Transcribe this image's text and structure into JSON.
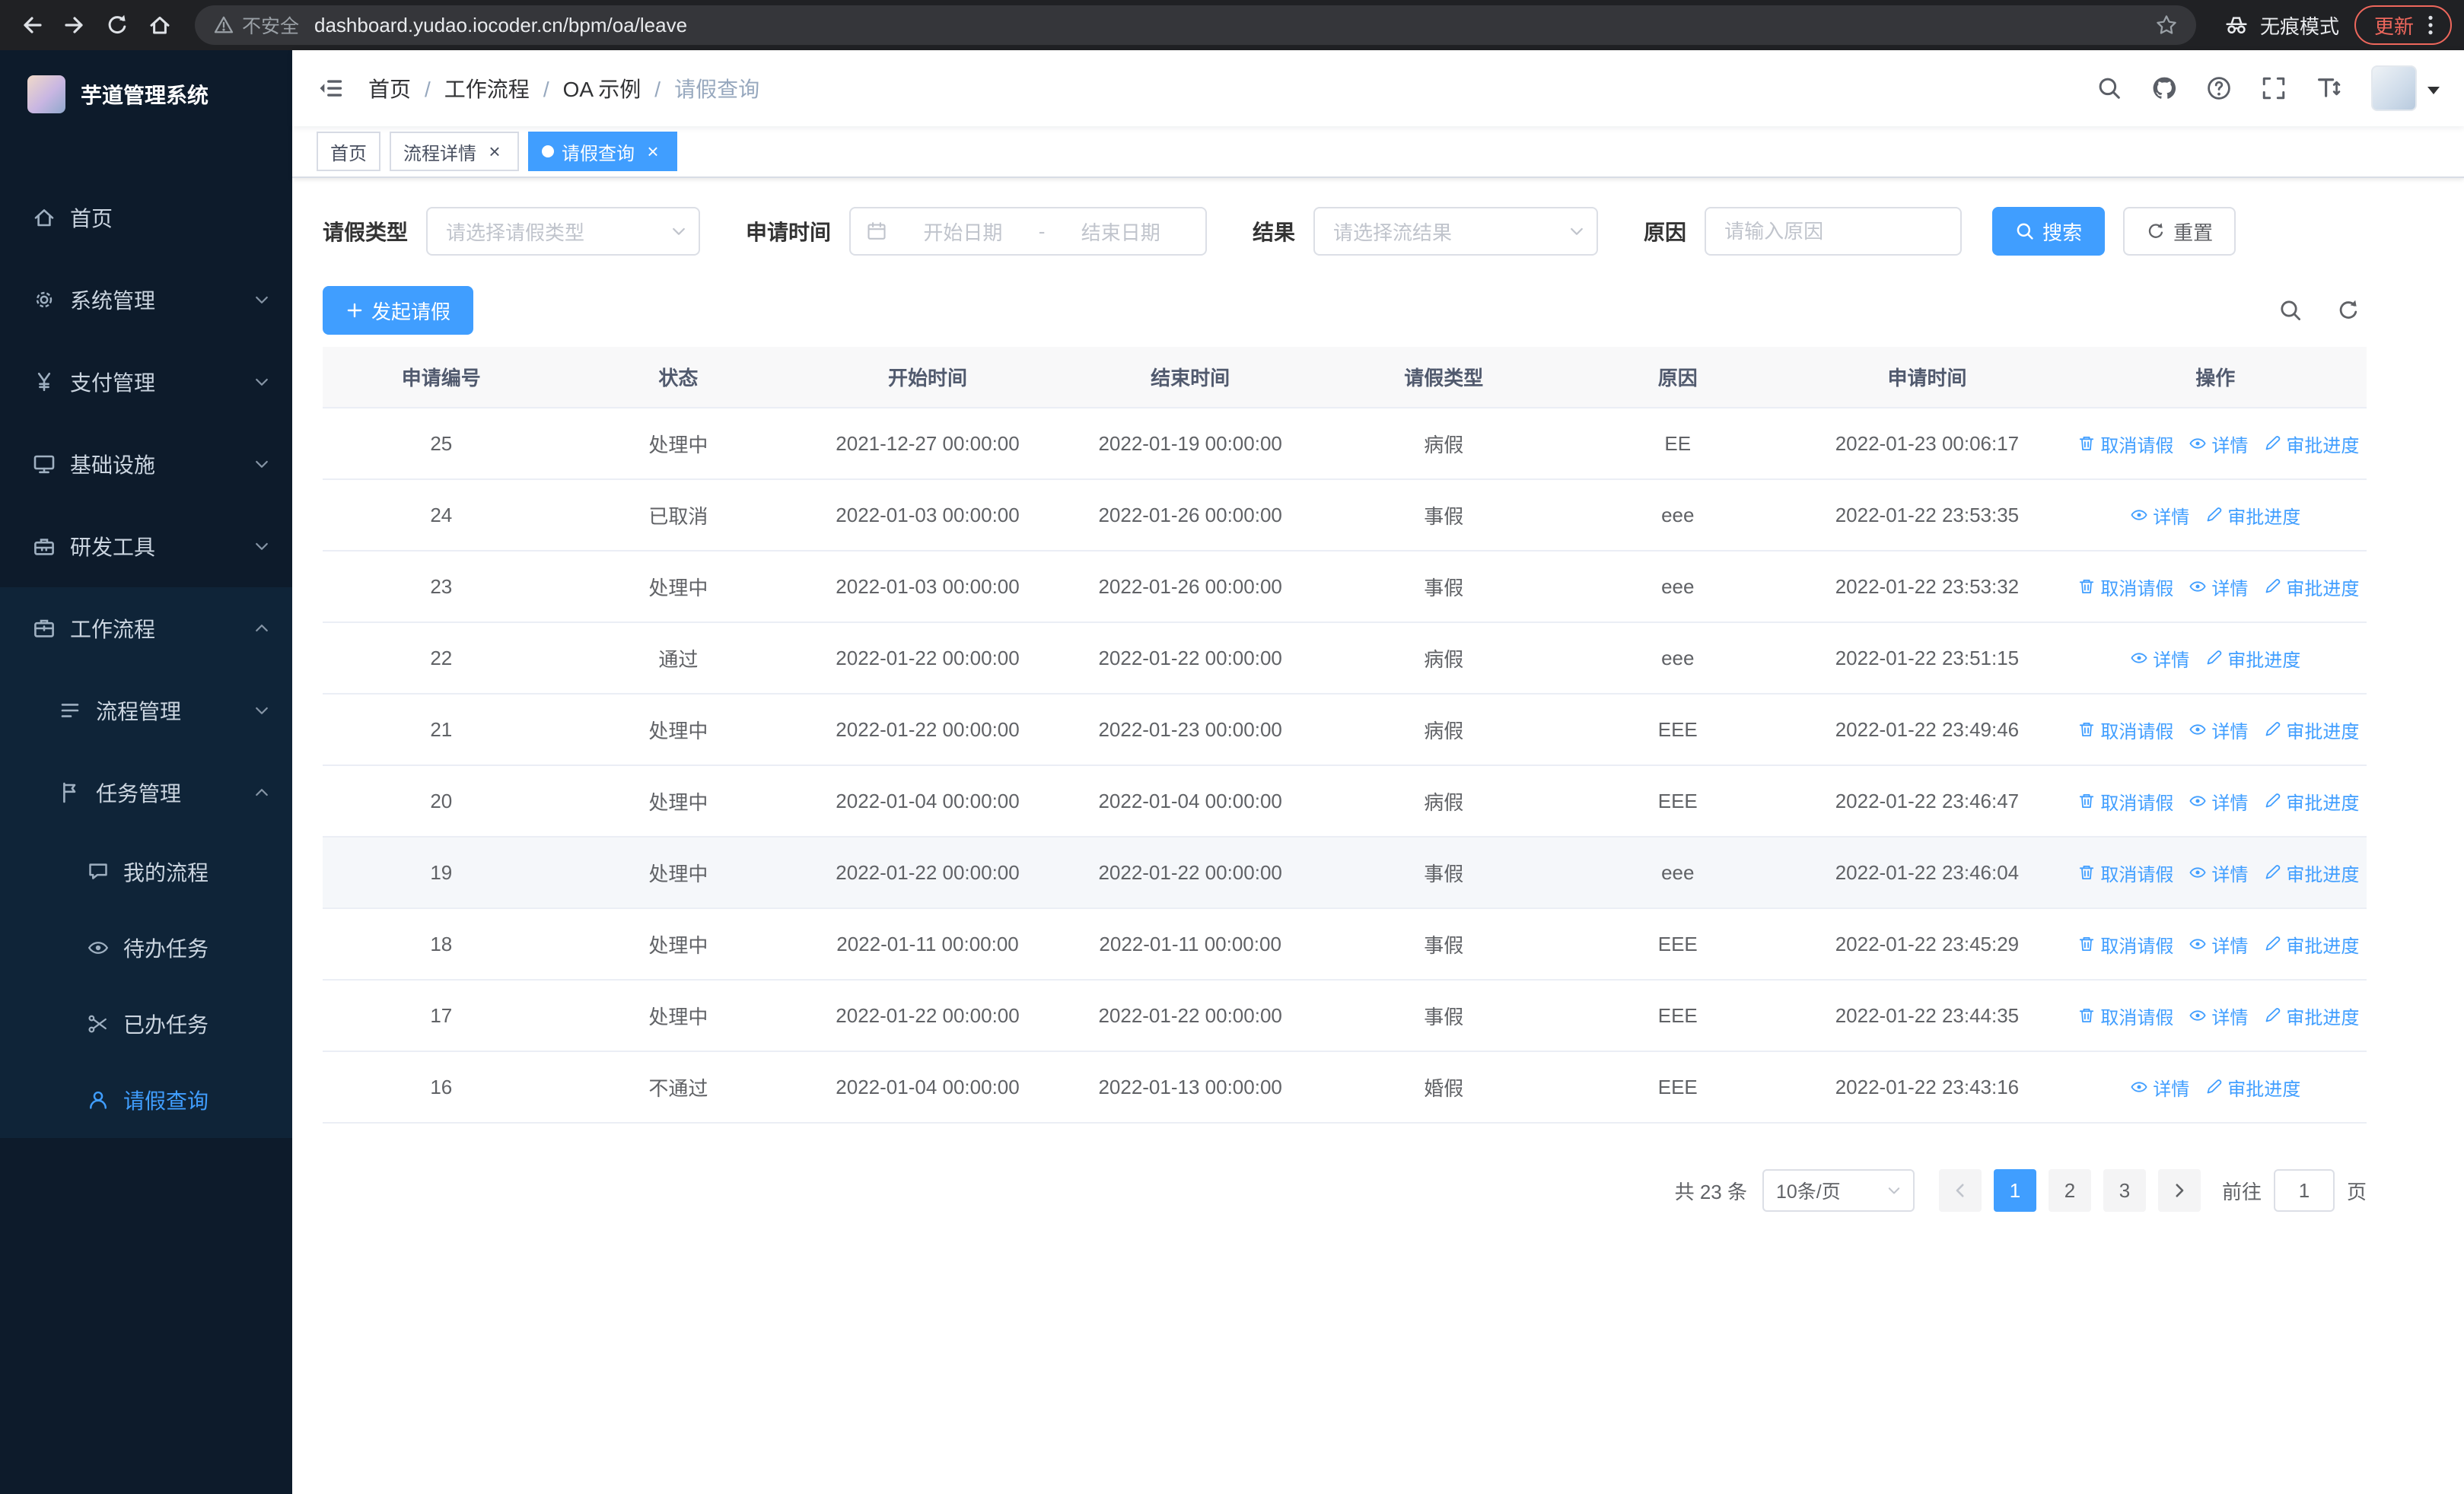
{
  "browser": {
    "security_warning": "不安全",
    "url": "dashboard.yudao.iocoder.cn/bpm/oa/leave",
    "incognito_label": "无痕模式",
    "update_label": "更新"
  },
  "sidebar": {
    "logo_title": "芋道管理系统",
    "items": [
      {
        "label": "首页"
      },
      {
        "label": "系统管理"
      },
      {
        "label": "支付管理"
      },
      {
        "label": "基础设施"
      },
      {
        "label": "研发工具"
      },
      {
        "label": "工作流程"
      }
    ],
    "workflow_children": [
      {
        "label": "流程管理"
      },
      {
        "label": "任务管理"
      }
    ],
    "task_children": [
      {
        "label": "我的流程"
      },
      {
        "label": "待办任务"
      },
      {
        "label": "已办任务"
      },
      {
        "label": "请假查询",
        "active": true
      }
    ]
  },
  "header": {
    "breadcrumb": [
      "首页",
      "工作流程",
      "OA 示例",
      "请假查询"
    ]
  },
  "tabs": [
    {
      "label": "首页"
    },
    {
      "label": "流程详情",
      "closable": true
    },
    {
      "label": "请假查询",
      "closable": true,
      "active": true
    }
  ],
  "filters": {
    "leave_type_label": "请假类型",
    "leave_type_placeholder": "请选择请假类型",
    "apply_time_label": "申请时间",
    "date_start_placeholder": "开始日期",
    "date_separator": "-",
    "date_end_placeholder": "结束日期",
    "result_label": "结果",
    "result_placeholder": "请选择流结果",
    "reason_label": "原因",
    "reason_placeholder": "请输入原因",
    "search_button": "搜索",
    "reset_button": "重置"
  },
  "toolbar": {
    "create_button": "发起请假"
  },
  "table": {
    "columns": [
      "申请编号",
      "状态",
      "开始时间",
      "结束时间",
      "请假类型",
      "原因",
      "申请时间",
      "操作"
    ],
    "action_labels": {
      "cancel": "取消请假",
      "detail": "详情",
      "progress": "审批进度"
    },
    "rows": [
      {
        "id": "25",
        "status": "处理中",
        "start_time": "2021-12-27 00:00:00",
        "end_time": "2022-01-19 00:00:00",
        "leave_type": "病假",
        "reason": "EE",
        "apply_time": "2022-01-23 00:06:17",
        "actions": [
          "cancel",
          "detail",
          "progress"
        ]
      },
      {
        "id": "24",
        "status": "已取消",
        "start_time": "2022-01-03 00:00:00",
        "end_time": "2022-01-26 00:00:00",
        "leave_type": "事假",
        "reason": "eee",
        "apply_time": "2022-01-22 23:53:35",
        "actions": [
          "detail",
          "progress"
        ]
      },
      {
        "id": "23",
        "status": "处理中",
        "start_time": "2022-01-03 00:00:00",
        "end_time": "2022-01-26 00:00:00",
        "leave_type": "事假",
        "reason": "eee",
        "apply_time": "2022-01-22 23:53:32",
        "actions": [
          "cancel",
          "detail",
          "progress"
        ]
      },
      {
        "id": "22",
        "status": "通过",
        "start_time": "2022-01-22 00:00:00",
        "end_time": "2022-01-22 00:00:00",
        "leave_type": "病假",
        "reason": "eee",
        "apply_time": "2022-01-22 23:51:15",
        "actions": [
          "detail",
          "progress"
        ]
      },
      {
        "id": "21",
        "status": "处理中",
        "start_time": "2022-01-22 00:00:00",
        "end_time": "2022-01-23 00:00:00",
        "leave_type": "病假",
        "reason": "EEE",
        "apply_time": "2022-01-22 23:49:46",
        "actions": [
          "cancel",
          "detail",
          "progress"
        ]
      },
      {
        "id": "20",
        "status": "处理中",
        "start_time": "2022-01-04 00:00:00",
        "end_time": "2022-01-04 00:00:00",
        "leave_type": "病假",
        "reason": "EEE",
        "apply_time": "2022-01-22 23:46:47",
        "actions": [
          "cancel",
          "detail",
          "progress"
        ]
      },
      {
        "id": "19",
        "status": "处理中",
        "start_time": "2022-01-22 00:00:00",
        "end_time": "2022-01-22 00:00:00",
        "leave_type": "事假",
        "reason": "eee",
        "apply_time": "2022-01-22 23:46:04",
        "actions": [
          "cancel",
          "detail",
          "progress"
        ],
        "highlighted": true
      },
      {
        "id": "18",
        "status": "处理中",
        "start_time": "2022-01-11 00:00:00",
        "end_time": "2022-01-11 00:00:00",
        "leave_type": "事假",
        "reason": "EEE",
        "apply_time": "2022-01-22 23:45:29",
        "actions": [
          "cancel",
          "detail",
          "progress"
        ]
      },
      {
        "id": "17",
        "status": "处理中",
        "start_time": "2022-01-22 00:00:00",
        "end_time": "2022-01-22 00:00:00",
        "leave_type": "事假",
        "reason": "EEE",
        "apply_time": "2022-01-22 23:44:35",
        "actions": [
          "cancel",
          "detail",
          "progress"
        ]
      },
      {
        "id": "16",
        "status": "不通过",
        "start_time": "2022-01-04 00:00:00",
        "end_time": "2022-01-13 00:00:00",
        "leave_type": "婚假",
        "reason": "EEE",
        "apply_time": "2022-01-22 23:43:16",
        "actions": [
          "detail",
          "progress"
        ]
      }
    ]
  },
  "pagination": {
    "total_text": "共 23 条",
    "page_size": "10条/页",
    "pages": [
      "1",
      "2",
      "3"
    ],
    "active_page": "1",
    "goto_label": "前往",
    "goto_value": "1",
    "goto_unit": "页"
  }
}
